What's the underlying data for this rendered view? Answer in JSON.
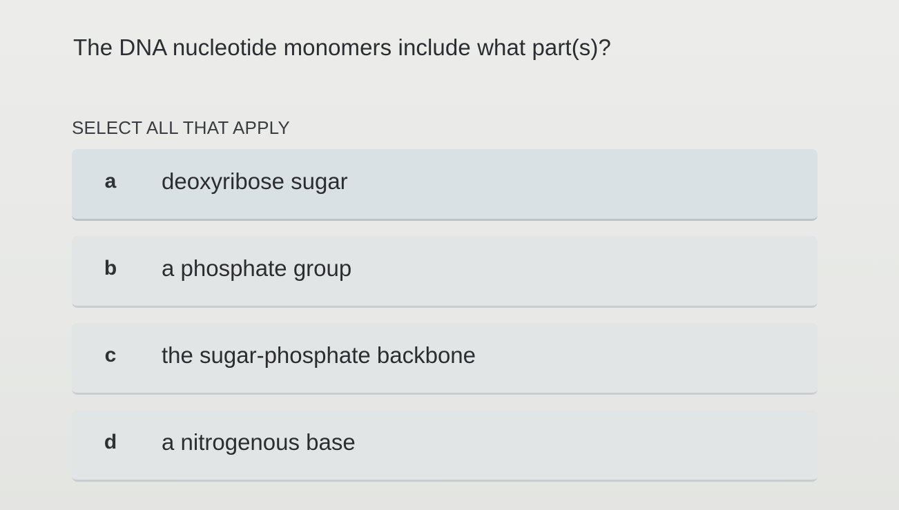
{
  "question": {
    "text": "The DNA nucleotide monomers include what part(s)?"
  },
  "instruction": "SELECT ALL THAT APPLY",
  "options": [
    {
      "letter": "a",
      "text": "deoxyribose sugar"
    },
    {
      "letter": "b",
      "text": "a phosphate group"
    },
    {
      "letter": "c",
      "text": "the sugar-phosphate backbone"
    },
    {
      "letter": "d",
      "text": "a nitrogenous base"
    }
  ],
  "colors": {
    "background": "#e9eae7",
    "option_background": "#e2e5e6",
    "option_highlight": "#d9e1e5",
    "text": "#2b2d31"
  }
}
